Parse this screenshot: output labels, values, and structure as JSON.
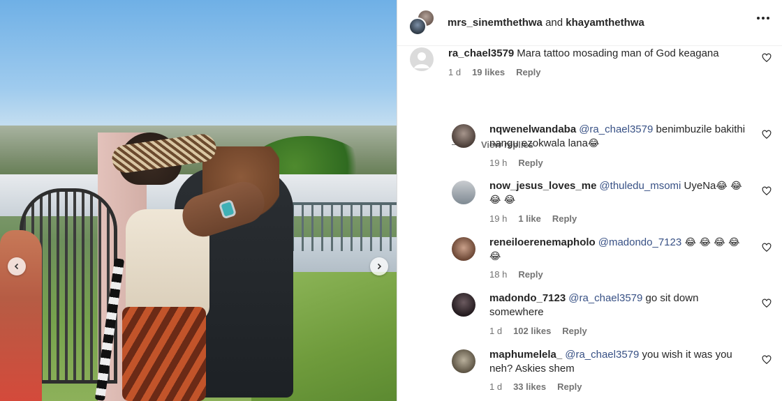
{
  "header": {
    "user1": "mrs_sinemthethwa",
    "joiner": "and",
    "user2": "khayamthethwa"
  },
  "icons": {
    "more": "more-options-icon",
    "heart": "heart-outline-icon",
    "prev": "chevron-left-icon",
    "next": "chevron-right-icon"
  },
  "main_comment": {
    "user": "ra_chael3579",
    "text": "Mara tattoo mosading man of God keagana",
    "time": "1 d",
    "likes": "19 likes",
    "reply": "Reply"
  },
  "view_replies": "View replies",
  "replies": [
    {
      "user": "nqwenelwandaba",
      "mention": "@ra_chael3579",
      "text": " benimbuzile bakithi nangu ezokwala lana",
      "emoji": "😂",
      "time": "19 h",
      "likes": "",
      "reply": "Reply"
    },
    {
      "user": "now_jesus_loves_me",
      "mention": "@thuledu_msomi",
      "text": " UyeNa",
      "emoji": "😂 😂 😂 😂",
      "time": "19 h",
      "likes": "1 like",
      "reply": "Reply"
    },
    {
      "user": "reneiloerenemapholo",
      "mention": "@madondo_7123",
      "text": "",
      "emoji": " 😂 😂 😂 😂 😂",
      "time": "18 h",
      "likes": "",
      "reply": "Reply"
    },
    {
      "user": "madondo_7123",
      "mention": "@ra_chael3579",
      "text": " go sit down somewhere",
      "emoji": "",
      "time": "1 d",
      "likes": "102 likes",
      "reply": "Reply"
    },
    {
      "user": "maphumelela_",
      "mention": "@ra_chael3579",
      "text": " you wish it was you neh? Askies shem",
      "emoji": "",
      "time": "1 d",
      "likes": "33 likes",
      "reply": "Reply"
    }
  ]
}
